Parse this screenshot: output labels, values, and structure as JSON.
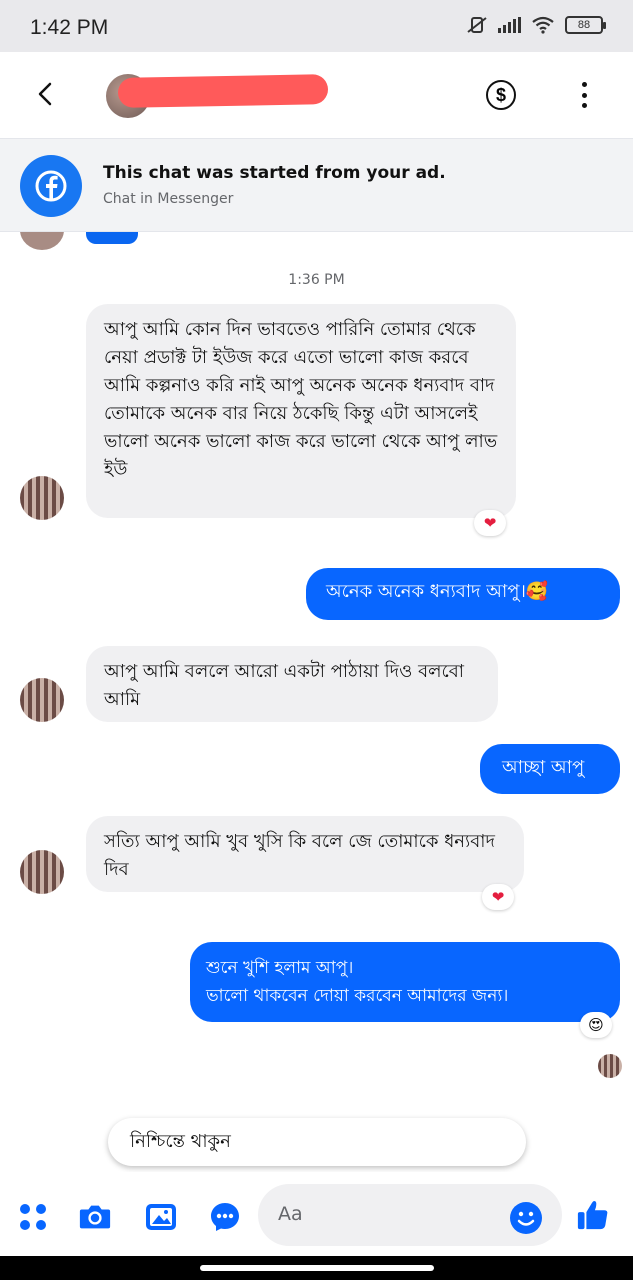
{
  "status_bar": {
    "time": "1:42 PM",
    "battery": "88"
  },
  "header": {
    "back_icon": "chevron-left-icon",
    "payment_icon": "dollar-icon",
    "more_icon": "more-vertical-icon"
  },
  "ad_banner": {
    "title": "This chat was started from your ad.",
    "subtitle": "Chat in Messenger"
  },
  "chat": {
    "timestamp": "1:36 PM",
    "messages": [
      {
        "direction": "in",
        "text": "আপু আমি কোন দিন ভাবতেও পারিনি তোমার থেকে নেয়া প্রডাক্ট টা ইউজ করে এতো ভালো কাজ করবে আমি কল্পনাও করি নাই আপু অনেক অনেক ধন্যবাদ বাদ তোমাকে অনেক বার নিয়ে ঠকেছি কিন্তু এটা আসলেই ভালো অনেক ভালো কাজ করে ভালো থেকে আপু লাভ ইউ",
        "reaction": "❤"
      },
      {
        "direction": "out",
        "text": "অনেক অনেক ধন্যবাদ আপু।🥰"
      },
      {
        "direction": "in",
        "text": "আপু আমি বললে আরো একটা পাঠায়া দিও বলবো আমি"
      },
      {
        "direction": "out",
        "text": "আচ্ছা আপু"
      },
      {
        "direction": "in",
        "text": "সত্যি আপু আমি খুব খুসি কি বলে জে তোমাকে ধন্যবাদ দিব",
        "reaction": "❤"
      },
      {
        "direction": "out",
        "line1": "শুনে খুশি হলাম আপু।",
        "line2": "ভালো থাকবেন দোয়া করবেন আমাদের জন্য।",
        "reaction": "😍"
      }
    ]
  },
  "quick_reply": "নিশ্চিন্তে থাকুন",
  "composer": {
    "placeholder": "Aa",
    "tools": [
      "apps-icon",
      "camera-icon",
      "image-icon",
      "chat-bubble-icon"
    ],
    "emoji_icon": "smiley-icon",
    "like_icon": "thumbs-up-icon"
  },
  "colors": {
    "accent": "#0866ff",
    "incoming_bubble": "#f0f0f2",
    "heart": "#e41e3f"
  }
}
